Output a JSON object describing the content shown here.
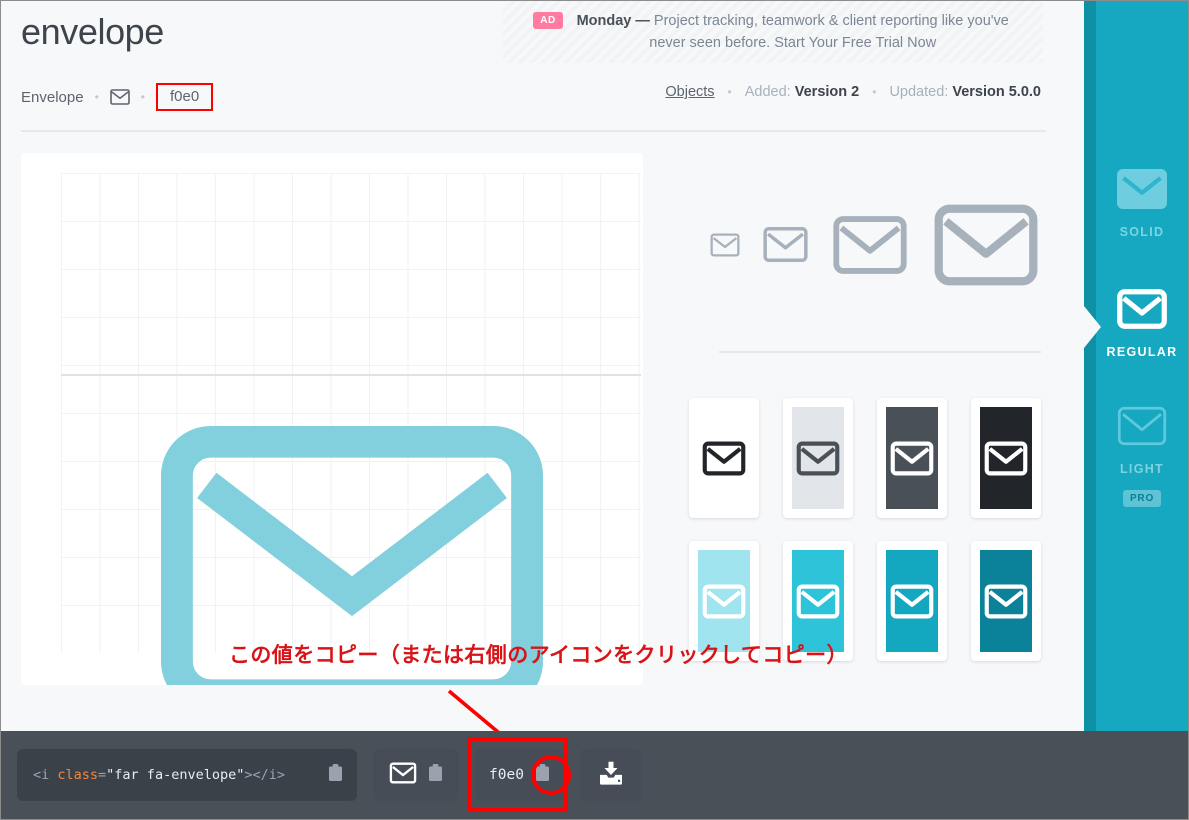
{
  "ad": {
    "badge": "AD",
    "brand": "Monday —",
    "text": " Project tracking, teamwork & client reporting like you've never seen before. Start Your Free Trial Now"
  },
  "header": {
    "title": "envelope",
    "breadcrumb": {
      "name": "Envelope",
      "icon_name": "envelope-icon",
      "separator": "•",
      "unicode": "f0e0"
    },
    "meta": {
      "category_link": "Objects",
      "separator": "•",
      "added_label": "Added: ",
      "added_value": "Version 2",
      "updated_label": "Updated: ",
      "updated_value": "Version 5.0.0"
    }
  },
  "preview": {
    "icon_name": "envelope-regular-icon",
    "icon_color": "#82cfdd",
    "background": "#ffffff",
    "grid_color": "#f0f2f4",
    "baseline_color": "#dfe3e7"
  },
  "size_ramp": {
    "color": "#a7b1bc",
    "sizes": [
      22,
      30,
      46,
      62
    ]
  },
  "swatches": [
    {
      "name": "white-swatch",
      "bg": "#ffffff",
      "icon": "#22262b"
    },
    {
      "name": "light-gray-swatch",
      "bg": "#e2e6ea",
      "icon": "#4a5058"
    },
    {
      "name": "dark-slate-swatch",
      "bg": "#4a5058",
      "icon": "#ffffff"
    },
    {
      "name": "near-black-swatch",
      "bg": "#22262b",
      "icon": "#ffffff"
    },
    {
      "name": "pale-cyan-swatch",
      "bg": "#9fe4ef",
      "icon": "#ffffff"
    },
    {
      "name": "cyan-swatch",
      "bg": "#2dc3d8",
      "icon": "#ffffff"
    },
    {
      "name": "teal-swatch",
      "bg": "#14a7c0",
      "icon": "#ffffff"
    },
    {
      "name": "dark-teal-swatch",
      "bg": "#0b8299",
      "icon": "#ffffff"
    }
  ],
  "annotation": {
    "text": "この値をコピー（または右側のアイコンをクリックしてコピー）",
    "color": "#d81418"
  },
  "sidebar": {
    "accent": "#15a8c0",
    "edge": "#0e90a5",
    "styles": [
      {
        "label": "SOLID",
        "icon_name": "envelope-solid-icon",
        "active": false,
        "pro": false
      },
      {
        "label": "REGULAR",
        "icon_name": "envelope-regular-icon",
        "active": true,
        "pro": false
      },
      {
        "label": "LIGHT",
        "icon_name": "envelope-light-icon",
        "active": false,
        "pro": true,
        "pro_label": "PRO"
      }
    ]
  },
  "bottombar": {
    "background": "#4a5058",
    "code": {
      "open_bracket": "<i ",
      "attr": "class",
      "equals": "=",
      "value": "\"far fa-envelope\"",
      "close": "></i>",
      "full": "<i class=\"far fa-envelope\"></i>",
      "copy_icon": "clipboard-icon"
    },
    "glyph_button": {
      "icon_name": "envelope-glyph-icon",
      "copy_icon": "clipboard-icon"
    },
    "unicode_button": {
      "value": "f0e0",
      "copy_icon": "clipboard-icon"
    },
    "download_button": {
      "icon_name": "download-icon"
    }
  }
}
